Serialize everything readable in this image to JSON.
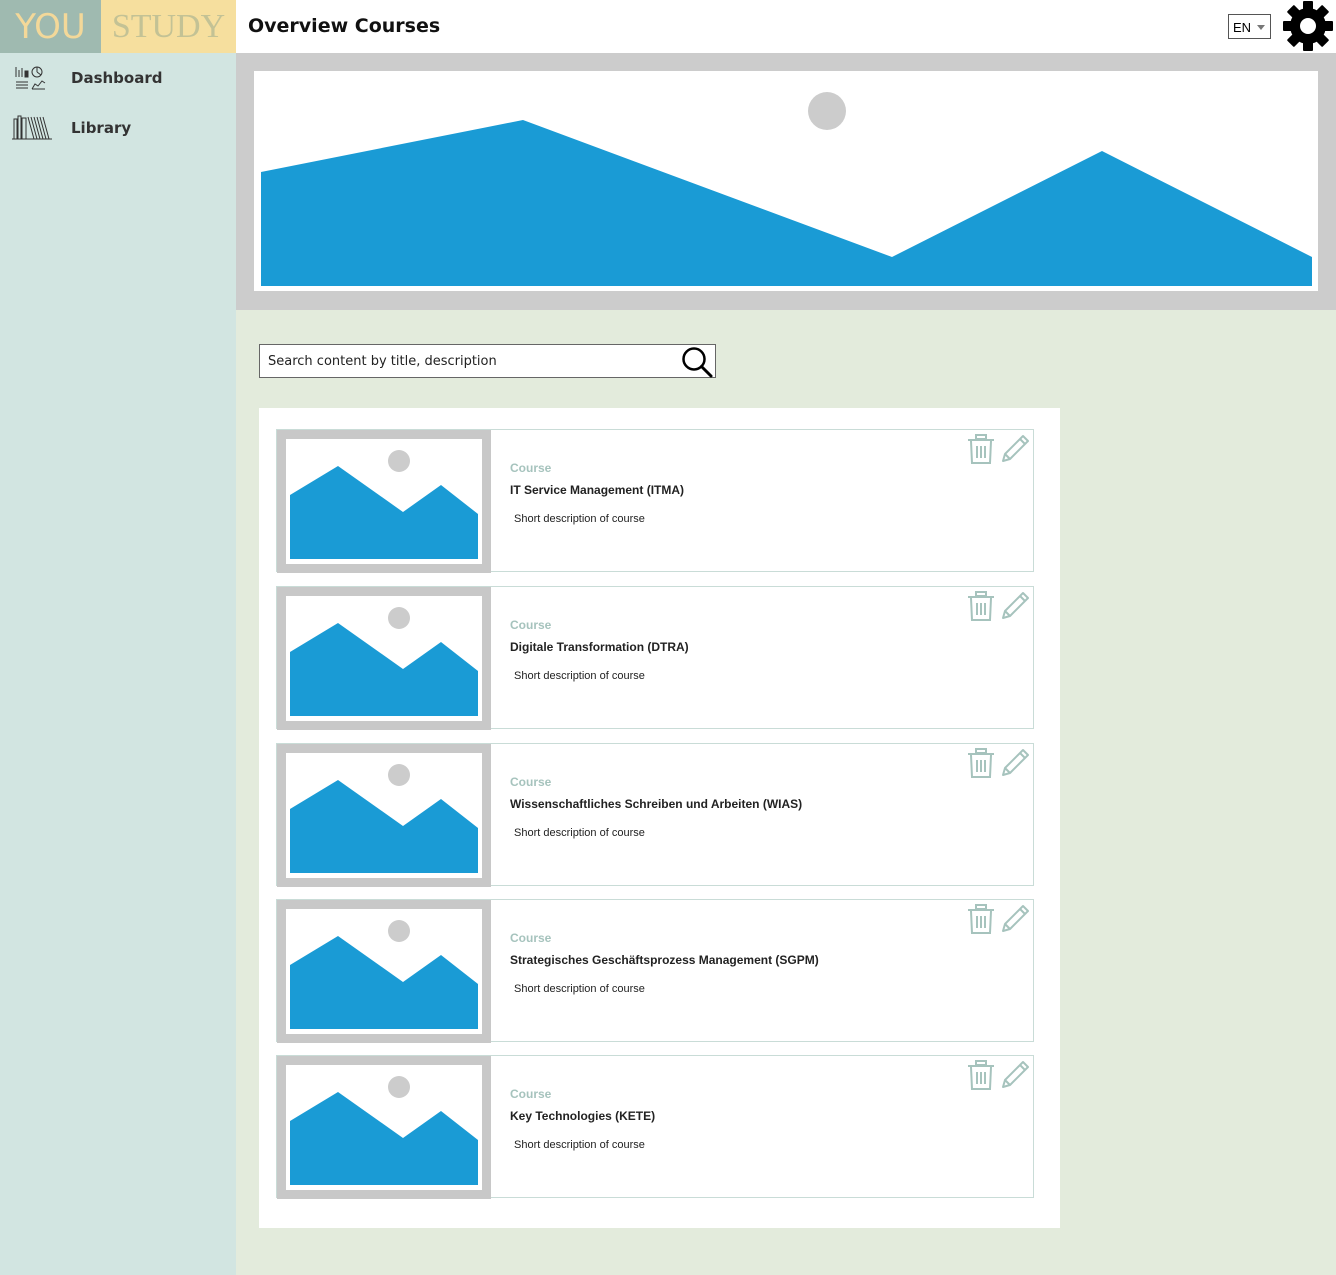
{
  "logo": {
    "part1": "YOU",
    "part2": "STUDY"
  },
  "header": {
    "title": "Overview Courses",
    "language": "EN"
  },
  "sidebar": {
    "items": [
      {
        "label": "Dashboard",
        "icon": "dashboard-icon"
      },
      {
        "label": "Library",
        "icon": "library-icon"
      }
    ]
  },
  "search": {
    "placeholder": "Search content by title, description",
    "value": ""
  },
  "courses": [
    {
      "kind": "Course",
      "title": "IT Service Management (ITMA)",
      "description": "Short description of course"
    },
    {
      "kind": "Course",
      "title": "Digitale Transformation (DTRA)",
      "description": "Short description of course"
    },
    {
      "kind": "Course",
      "title": "Wissenschaftliches Schreiben und Arbeiten (WIAS)",
      "description": "Short description of course"
    },
    {
      "kind": "Course",
      "title": "Strategisches Geschäftsprozess Management (SGPM)",
      "description": "Short description of course"
    },
    {
      "kind": "Course",
      "title": "Key Technologies (KETE)",
      "description": "Short description of course"
    }
  ],
  "colors": {
    "sidebar_bg": "#d2e5e1",
    "main_bg": "#e3ebdc",
    "logo_you_bg": "#9fbab0",
    "logo_study_bg": "#f6df9e",
    "placeholder_blue": "#1a9bd5",
    "icon_muted": "#a6c3bd"
  }
}
